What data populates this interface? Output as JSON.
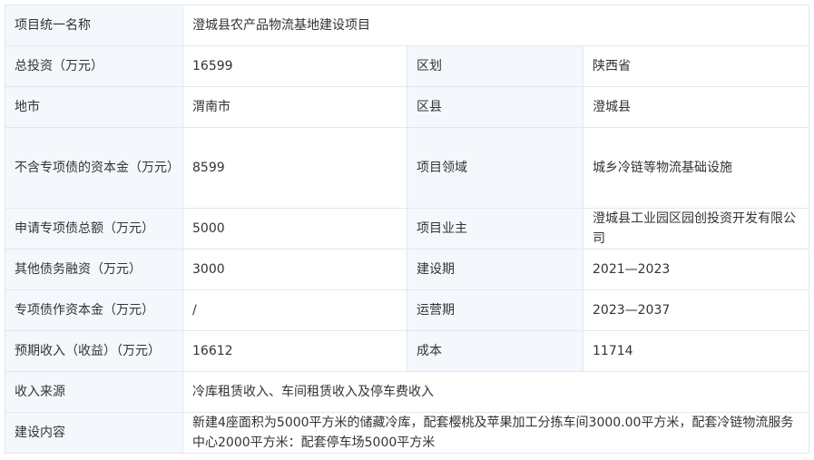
{
  "table": {
    "project_name_label": "项目统一名称",
    "project_name": "澄城县农产品物流基地建设项目",
    "total_investment_label": "总投资（万元）",
    "total_investment": "16599",
    "district_label": "区划",
    "district": "陕西省",
    "city_label": "地市",
    "city": "渭南市",
    "county_label": "区县",
    "county": "澄城县",
    "capital_excl_label": "不含专项债的资本金（万元）",
    "capital_excl": "8599",
    "field_label": "项目领域",
    "field": "城乡冷链等物流基础设施",
    "special_bond_total_label": "申请专项债总额（万元）",
    "special_bond_total": "5000",
    "owner_label": "项目业主",
    "owner": "澄城县工业园区园创投资开发有限公司",
    "other_debt_label": "其他债务融资（万元）",
    "other_debt": "3000",
    "construction_period_label": "建设期",
    "construction_period": "2021—2023",
    "bond_as_capital_label": "专项债作资本金（万元）",
    "bond_as_capital": "/",
    "operation_period_label": "运营期",
    "operation_period": "2023—2037",
    "expected_income_label": "预期收入（收益）（万元）",
    "expected_income": "16612",
    "cost_label": "成本",
    "cost": "11714",
    "income_source_label": "收入来源",
    "income_source": "冷库租赁收入、车间租赁收入及停车费收入",
    "construction_content_label": "建设内容",
    "construction_content": "新建4座面积为5000平方米的储藏冷库，配套樱桃及苹果加工分拣车间3000.00平方米，配套冷链物流服务中心2000平方米：配套停车场5000平方米"
  }
}
